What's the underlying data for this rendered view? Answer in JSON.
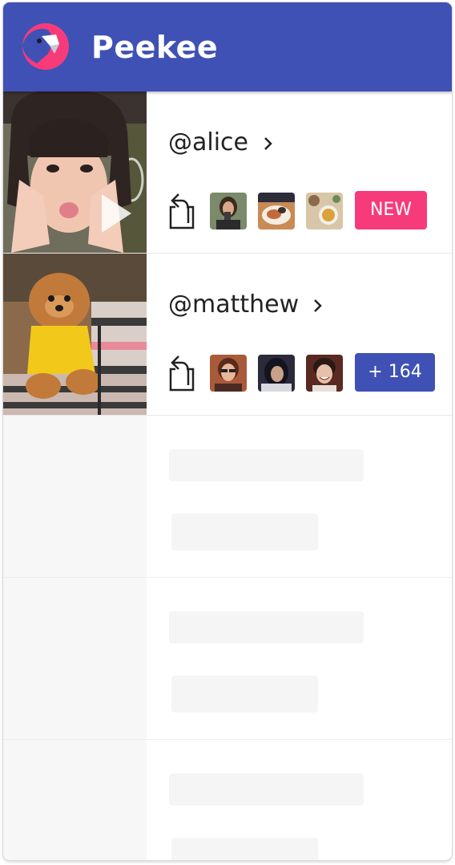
{
  "app": {
    "title": "Peekee",
    "brand_color": "#3f51b5",
    "accent_color": "#f73b7a"
  },
  "feed": [
    {
      "username": "@alice",
      "badge": "NEW",
      "badge_color": "#f73b7a",
      "has_play_icon": true,
      "thumbnail": "selfie-photo",
      "mini_photos": [
        "person-drinking-photo",
        "food-plate-photo",
        "tea-cups-photo"
      ]
    },
    {
      "username": "@matthew",
      "badge": "+ 164",
      "badge_color": "#3f51b5",
      "has_play_icon": false,
      "thumbnail": "pomeranian-dog-photo",
      "mini_photos": [
        "woman-glasses-photo",
        "dark-hair-portrait-photo",
        "smiling-person-photo"
      ]
    }
  ],
  "placeholders": 3
}
